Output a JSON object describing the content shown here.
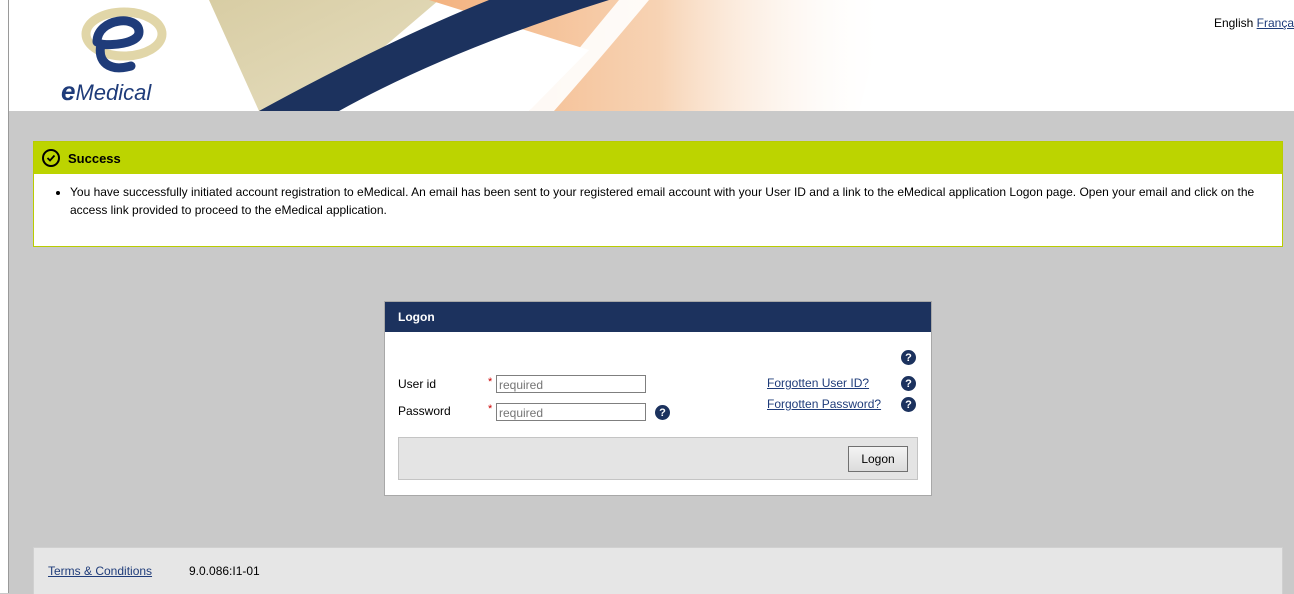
{
  "header": {
    "logo_text": "Medical",
    "logo_letter": "e",
    "languages": {
      "current": "English",
      "other": "França"
    }
  },
  "success": {
    "title": "Success",
    "messages": [
      "You have successfully initiated account registration to eMedical. An email has been sent to your registered email account with your User ID and a link to the eMedical application Logon page.  Open your email and click on the access link provided to proceed to the eMedical application."
    ]
  },
  "logon": {
    "title": "Logon",
    "user_label": "User id",
    "password_label": "Password",
    "required_mark": "*",
    "user_placeholder": "required",
    "password_placeholder": "required",
    "forgot_user": "Forgotten User ID?",
    "forgot_password": "Forgotten Password?",
    "help_glyph": "?",
    "button": "Logon"
  },
  "footer": {
    "terms": "Terms & Conditions",
    "version": "9.0.086:I1-01"
  },
  "colors": {
    "navy": "#1c325e",
    "success_green": "#bcd400",
    "page_bg": "#c9c9c9"
  }
}
